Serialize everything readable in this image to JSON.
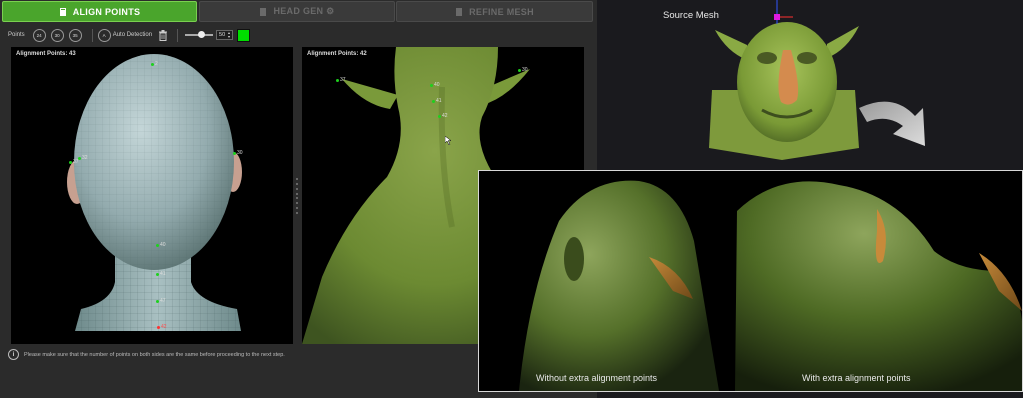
{
  "tabs": [
    {
      "label": "ALIGN POINTS",
      "active": true
    },
    {
      "label": "HEAD GEN ⚙",
      "active": false
    },
    {
      "label": "REFINE MESH",
      "active": false
    }
  ],
  "toolbar": {
    "points_label": "Points",
    "mode_buttons": [
      "24",
      "30",
      "35"
    ],
    "auto_detection_label": "Auto Detection",
    "size_value": "50",
    "slider_level": 0.6,
    "point_color": "#00dd00"
  },
  "left_panel": {
    "title": "Alignment Points: 43",
    "points": [
      {
        "label": "2"
      },
      {
        "label": "37"
      },
      {
        "label": "32"
      },
      {
        "label": "30"
      },
      {
        "label": "40"
      },
      {
        "label": "41"
      },
      {
        "label": "47"
      },
      {
        "label": "42",
        "selected": true
      }
    ]
  },
  "right_panel": {
    "title": "Alignment Points: 42",
    "points": [
      {
        "label": "37"
      },
      {
        "label": "30"
      },
      {
        "label": "40"
      },
      {
        "label": "41"
      },
      {
        "label": "42"
      }
    ]
  },
  "footer_note": "Please make sure that the number of points on both sides are the same before proceeding to the next step.",
  "source_mesh_label": "Source Mesh",
  "comparison": {
    "left_caption": "Without extra alignment points",
    "right_caption": "With extra alignment points"
  },
  "colors": {
    "accent": "#4aa52c",
    "point_green": "#1dd11d",
    "point_red": "#ff3030",
    "mesh_green": "#7a9a3a"
  }
}
